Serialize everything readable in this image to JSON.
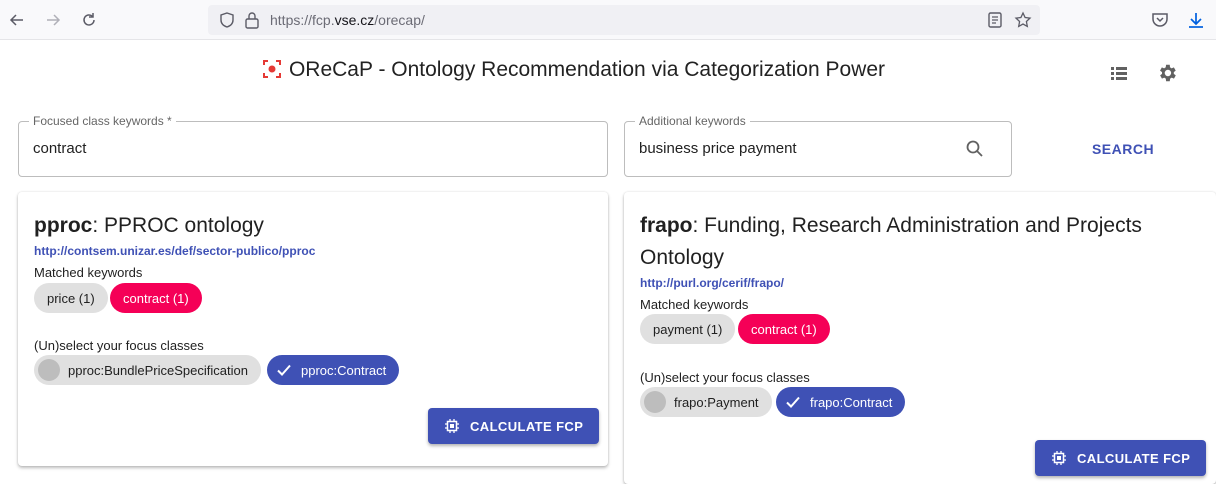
{
  "browser": {
    "url_prefix": "https://fcp.",
    "url_domain": "vse.cz",
    "url_suffix": "/orecap/"
  },
  "app": {
    "title": "OReCaP - Ontology Recommendation via Categorization Power"
  },
  "search": {
    "focused_label": "Focused class keywords *",
    "focused_value": "contract",
    "additional_label": "Additional keywords",
    "additional_value": "business price payment",
    "search_label": "SEARCH"
  },
  "cards": [
    {
      "prefix": "pproc",
      "title_rest": ": PPROC ontology",
      "url": "http://contsem.unizar.es/def/sector-publico/pproc",
      "matched_label": "Matched keywords",
      "keywords": [
        {
          "label": "price (1)",
          "style": "grey"
        },
        {
          "label": "contract (1)",
          "style": "pink"
        }
      ],
      "focus_label": "(Un)select your focus classes",
      "classes": [
        {
          "label": "pproc:BundlePriceSpecification",
          "selected": false
        },
        {
          "label": "pproc:Contract",
          "selected": true
        }
      ],
      "button_label": "CALCULATE FCP"
    },
    {
      "prefix": "frapo",
      "title_rest": ": Funding, Research Administration and Projects Ontology",
      "url": "http://purl.org/cerif/frapo/",
      "matched_label": "Matched keywords",
      "keywords": [
        {
          "label": "payment (1)",
          "style": "grey"
        },
        {
          "label": "contract (1)",
          "style": "pink"
        }
      ],
      "focus_label": "(Un)select your focus classes",
      "classes": [
        {
          "label": "frapo:Payment",
          "selected": false
        },
        {
          "label": "frapo:Contract",
          "selected": true
        }
      ],
      "button_label": "CALCULATE FCP"
    }
  ],
  "colors": {
    "primary": "#3f51b5",
    "accent": "#f50057",
    "chip_grey": "#e0e0e0",
    "logo_red": "#e53935"
  },
  "icons": {
    "back": "arrow-left-icon",
    "forward": "arrow-right-icon",
    "reload": "reload-icon",
    "shield": "shield-icon",
    "lock": "lock-icon",
    "reader": "reader-view-icon",
    "bookmark": "star-icon",
    "pocket": "pocket-icon",
    "download": "download-icon",
    "logo": "focus-target-icon",
    "list": "list-icon",
    "settings": "gear-icon",
    "search": "search-icon",
    "cpu": "cpu-chip-icon",
    "check": "check-icon"
  }
}
